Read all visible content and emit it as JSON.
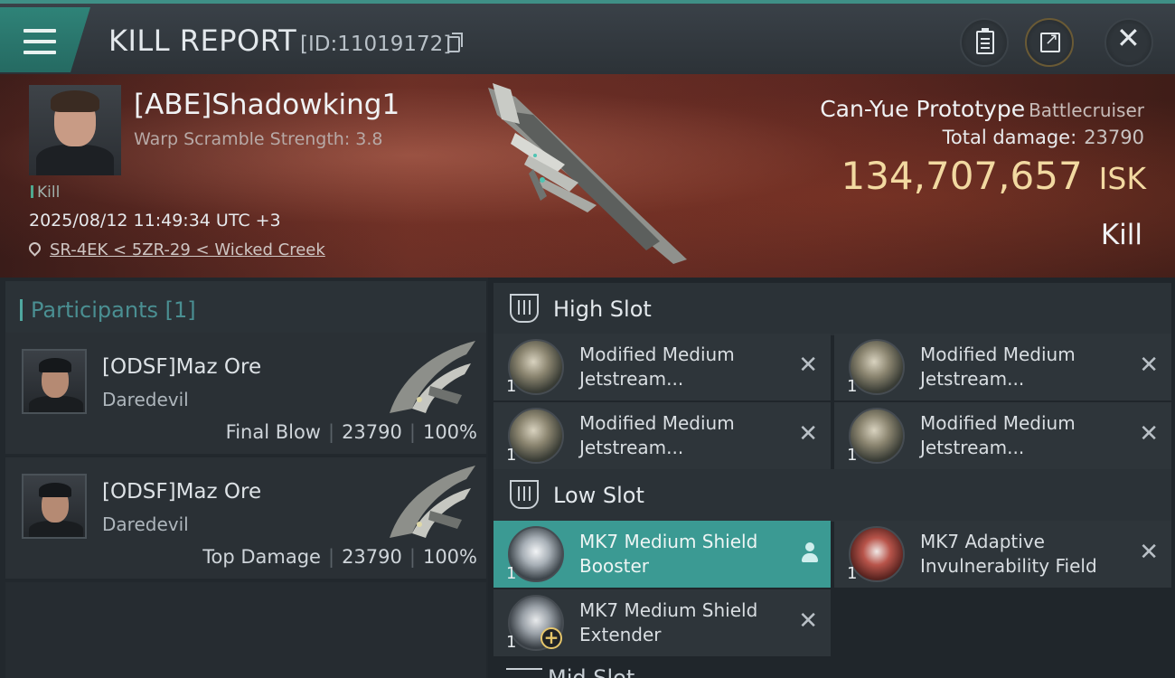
{
  "window": {
    "title": "KILL REPORT",
    "report_id": "[ID:11019172]"
  },
  "victim": {
    "name": "[ABE]Shadowking1",
    "warp_scramble": "Warp Scramble Strength: 3.8",
    "tag": "Kill",
    "datetime": "2025/08/12 11:49:34 UTC +3",
    "location": "SR-4EK < 5ZR-29 < Wicked Creek",
    "ship_name": "Can-Yue Prototype",
    "ship_class": "Battlecruiser",
    "total_damage_label": "Total damage:",
    "total_damage": "23790",
    "isk_value": "134,707,657",
    "isk_unit": "ISK",
    "result": "Kill"
  },
  "participants": {
    "header": "Participants [1]",
    "items": [
      {
        "name": "[ODSF]Maz Ore",
        "ship": "Daredevil",
        "role": "Final Blow",
        "damage": "23790",
        "percent": "100%",
        "sep": "|"
      },
      {
        "name": "[ODSF]Maz Ore",
        "ship": "Daredevil",
        "role": "Top Damage",
        "damage": "23790",
        "percent": "100%",
        "sep": "|"
      }
    ]
  },
  "slots": {
    "high": {
      "title": "High Slot",
      "items": [
        {
          "name": "Modified Medium Jetstream...",
          "qty": "1"
        },
        {
          "name": "Modified Medium Jetstream...",
          "qty": "1"
        },
        {
          "name": "Modified Medium Jetstream...",
          "qty": "1"
        },
        {
          "name": "Modified Medium Jetstream...",
          "qty": "1"
        }
      ]
    },
    "low": {
      "title": "Low Slot",
      "items": [
        {
          "name": "MK7 Medium Shield Booster",
          "qty": "1"
        },
        {
          "name": "MK7 Adaptive Invulnerability Field",
          "qty": "1"
        },
        {
          "name": "MK7 Medium Shield Extender",
          "qty": "1"
        }
      ]
    },
    "mid_partial": "Mid Slot"
  },
  "colors": {
    "accent": "#3b9a93",
    "isk": "#f2d9a1",
    "title_bar": "#2c3237"
  }
}
